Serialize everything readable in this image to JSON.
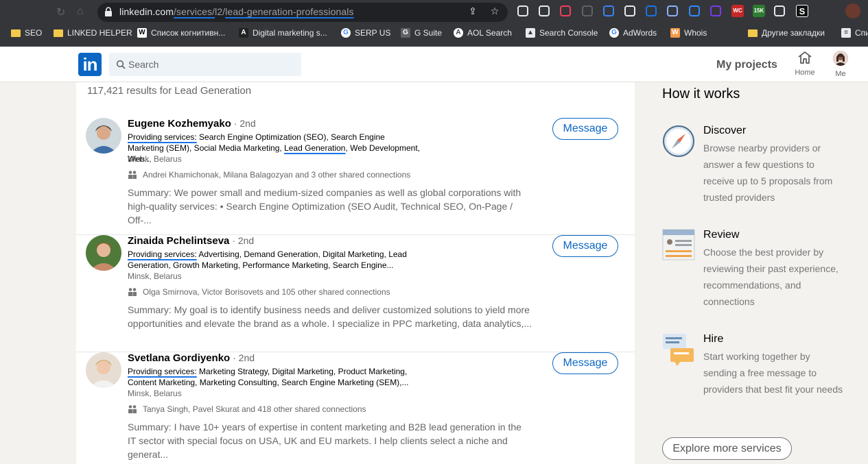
{
  "browser": {
    "url_host": "linkedin.com",
    "url_seg1": "/services/",
    "url_seg2": "l2/",
    "url_seg3": "lead-generation-professionals",
    "extensions": [
      {
        "icon": "ext-icon-1",
        "text": "",
        "color": "#e8eaed"
      },
      {
        "icon": "ext-icon-qr",
        "text": "",
        "color": "#e8eaed"
      },
      {
        "icon": "ext-icon-pocket",
        "text": "",
        "color": "#ef4056"
      },
      {
        "icon": "ext-icon-code",
        "text": "",
        "color": "#5f6368"
      },
      {
        "icon": "ext-icon-blue",
        "text": "",
        "color": "#3b82f6"
      },
      {
        "icon": "ext-icon-x",
        "text": "",
        "color": "#e8eaed"
      },
      {
        "icon": "ext-icon-play",
        "text": "",
        "color": "#1a73e8"
      },
      {
        "icon": "ext-icon-link",
        "text": "",
        "color": "#8ab4f8"
      },
      {
        "icon": "ext-icon-zoom",
        "text": "",
        "color": "#2d8cff"
      },
      {
        "icon": "ext-icon-purple",
        "text": "",
        "color": "#7c3aed"
      },
      {
        "icon": "ext-icon-wc",
        "text": "WC",
        "color": "#ffffff"
      },
      {
        "icon": "ext-icon-15k",
        "text": "15K",
        "color": "#34a853"
      },
      {
        "icon": "ext-icon-puzzle",
        "text": "",
        "color": "#e8eaed"
      },
      {
        "icon": "ext-icon-s",
        "text": "S",
        "color": "#ffffff"
      }
    ],
    "bookmarks": [
      {
        "label": "SEO",
        "icon": "folder-icon"
      },
      {
        "label": "LINKED HELPER",
        "icon": "folder-icon"
      },
      {
        "label": "Список когнитивн...",
        "icon": "wikipedia-icon"
      },
      {
        "label": "Digital marketing s...",
        "icon": "argo-icon"
      },
      {
        "label": "SERP US",
        "icon": "google-icon"
      },
      {
        "label": "G Suite",
        "icon": "gsuite-icon"
      },
      {
        "label": "AOL Search",
        "icon": "aol-icon"
      },
      {
        "label": "Search Console",
        "icon": "search-console-icon"
      },
      {
        "label": "AdWords",
        "icon": "google-icon"
      },
      {
        "label": "Whois",
        "icon": "whois-icon"
      },
      {
        "label": "Другие закладки",
        "icon": "folder-icon"
      },
      {
        "label": "Спи",
        "icon": "list-icon"
      }
    ]
  },
  "header": {
    "logo_text": "in",
    "search_placeholder": "Search",
    "my_projects": "My projects",
    "home_label": "Home",
    "me_label": "Me"
  },
  "results": {
    "count_text": "117,421 results for Lead Generation",
    "items": [
      {
        "name": "Eugene Kozhemyako",
        "degree": " · 2nd",
        "services_label": "Providing services:",
        "services_parts": [
          " Search Engine Optimization (SEO), Search Engine Marketing (SEM), Social Media Marketing, ",
          "Lead Generation",
          ", Web Development, Web..."
        ],
        "location": "Minsk, Belarus",
        "connections": "Andrei Khamichonak, Milana Balagozyan and 3 other shared connections",
        "summary": "Summary: We power small and medium-sized companies as well as global corporations with high-quality services: • Search Engine Optimization (SEO Audit, Technical SEO, On-Page / Off-...",
        "button": "Message"
      },
      {
        "name": "Zinaida Pchelintseva",
        "degree": " · 2nd",
        "services_label": "Providing services:",
        "services_parts": [
          " Advertising, Demand Generation, Digital Marketing, Lead Generation, Growth Marketing, Performance Marketing, Search Engine..."
        ],
        "location": "Minsk, Belarus",
        "connections": "Olga Smirnova, Victor Borisovets and 105 other shared connections",
        "summary": "Summary: My goal is to identify business needs and deliver customized solutions to yield more opportunities and elevate the brand as a whole. I specialize in PPC marketing, data analytics,...",
        "button": "Message"
      },
      {
        "name": "Svetlana Gordiyenko",
        "degree": " · 2nd",
        "services_label": "Providing services:",
        "services_parts": [
          " Marketing Strategy, Digital Marketing, Product Marketing, Content Marketing, Marketing Consulting, Search Engine Marketing (SEM),..."
        ],
        "location": "Minsk, Belarus",
        "connections": "Tanya Singh, Pavel Skurat and 418 other shared connections",
        "summary": "Summary: I have 10+ years of expertise in content marketing and B2B lead generation in the IT sector with special focus on USA, UK and EU markets. I help clients select a niche and generat...",
        "button": "Message"
      }
    ]
  },
  "how_it_works": {
    "title": "How it works",
    "steps": [
      {
        "title": "Discover",
        "desc": "Browse nearby providers or answer a few questions to receive up to 5 proposals from trusted providers",
        "icon": "compass-icon"
      },
      {
        "title": "Review",
        "desc": "Choose the best provider by reviewing their past experience, recommendations, and connections",
        "icon": "profile-card-icon"
      },
      {
        "title": "Hire",
        "desc": "Start working together by sending a free message to providers that best fit your needs",
        "icon": "chat-bubbles-icon"
      }
    ],
    "explore_button": "Explore more services"
  }
}
